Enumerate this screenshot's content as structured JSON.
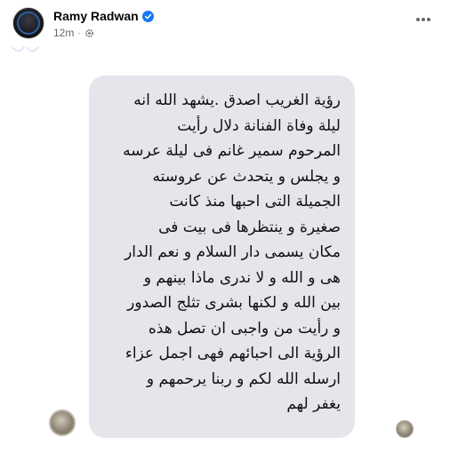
{
  "post": {
    "author": "Ramy Radwan",
    "time": "12m",
    "separator": "·",
    "icons": {
      "verified": "verified-badge-icon",
      "audience": "gear-icon",
      "more": "more-dots-icon"
    }
  },
  "bubble": {
    "lines": [
      "رؤية الغريب اصدق .يشهد الله انه",
      "ليلة وفاة الفنانة دلال رأيت",
      "المرحوم سمير غانم فى ليلة عرسه",
      "و يجلس و يتحدث عن عروسته",
      "الجميلة التى احبها منذ كانت",
      "صغيرة و ينتظرها فى بيت فى",
      "مكان يسمى دار السلام و نعم الدار",
      "هى و الله و لا ندرى ماذا بينهم و",
      "بين الله و لكنها بشرى تثلج الصدور",
      "و رأيت من واجبى ان تصل هذه",
      "الرؤية الى احبائهم فهى اجمل عزاء",
      "ارسله الله لكم و ربنا يرحمهم و",
      "يغفر لهم"
    ],
    "background": "#e4e6eb"
  },
  "colors": {
    "verified": "#1877f2",
    "meta": "#65676b"
  }
}
